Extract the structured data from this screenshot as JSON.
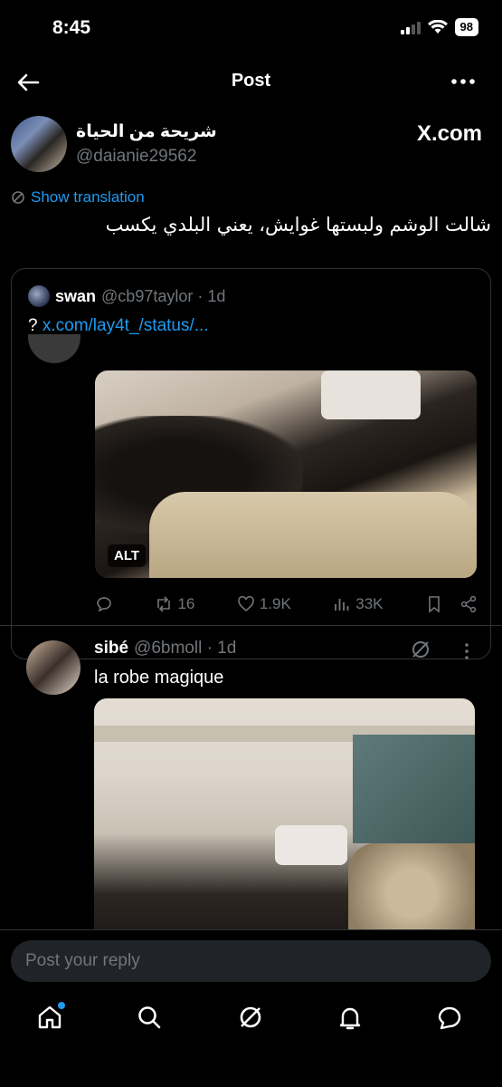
{
  "status_bar": {
    "time": "8:45",
    "battery": "98"
  },
  "nav": {
    "title": "Post"
  },
  "author": {
    "name": "شريحة من الحياة",
    "handle": "@daianie29562",
    "source_logo": "X.com"
  },
  "post": {
    "translate_label": "Show translation",
    "text": "شالت الوشم ولبستها غوايش، يعني البلدي يكسب"
  },
  "quote": {
    "name": "swan",
    "meta": "@cb97taylor · 1d",
    "question_mark": "?",
    "link": "x.com/lay4t_/status/...",
    "alt_badge": "ALT",
    "actions": {
      "retweets": "16",
      "likes": "1.9K",
      "views": "33K"
    }
  },
  "reply": {
    "name": "sibé",
    "meta": "@6bmoll · 1d",
    "text": "la robe magique"
  },
  "composer": {
    "placeholder": "Post your reply"
  },
  "colors": {
    "accent": "#1d9bf0",
    "background": "#000000",
    "muted": "#71767b",
    "border": "#2f3336"
  },
  "icons": [
    "back-arrow-icon",
    "more-dots-icon",
    "translate-icon",
    "reply-icon",
    "retweet-icon",
    "heart-icon",
    "views-icon",
    "bookmark-icon",
    "share-icon",
    "grok-icon",
    "home-icon",
    "search-icon",
    "notifications-icon",
    "messages-icon"
  ]
}
